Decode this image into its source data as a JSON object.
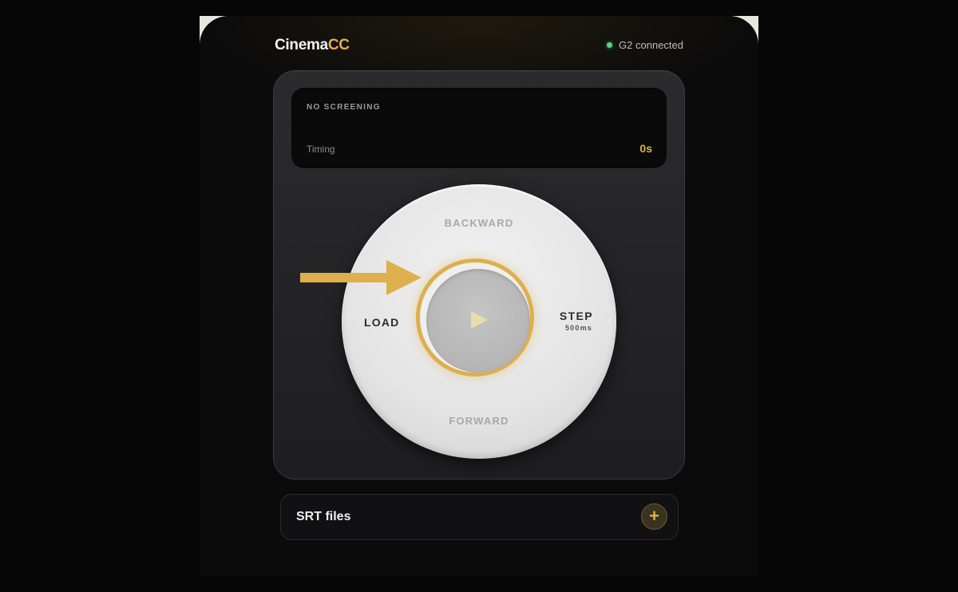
{
  "header": {
    "logo_prefix": "Cinema",
    "logo_accent": "CC",
    "status_text": "G2 connected",
    "status_color": "#5dd07b"
  },
  "screening": {
    "title": "NO SCREENING",
    "timing_label": "Timing",
    "timing_value": "0s"
  },
  "dial": {
    "backward_label": "BACKWARD",
    "forward_label": "FORWARD",
    "load_label": "LOAD",
    "step_label": "STEP",
    "step_value": "500ms",
    "play_icon": "play-icon"
  },
  "srt": {
    "title": "SRT files",
    "add_icon": "+"
  },
  "annotation": {
    "arrow_icon": "arrow-right-icon",
    "arrow_color": "#ddb04d"
  },
  "colors": {
    "accent": "#e0b04a",
    "background": "#0b0b0c",
    "card": "#242426"
  }
}
